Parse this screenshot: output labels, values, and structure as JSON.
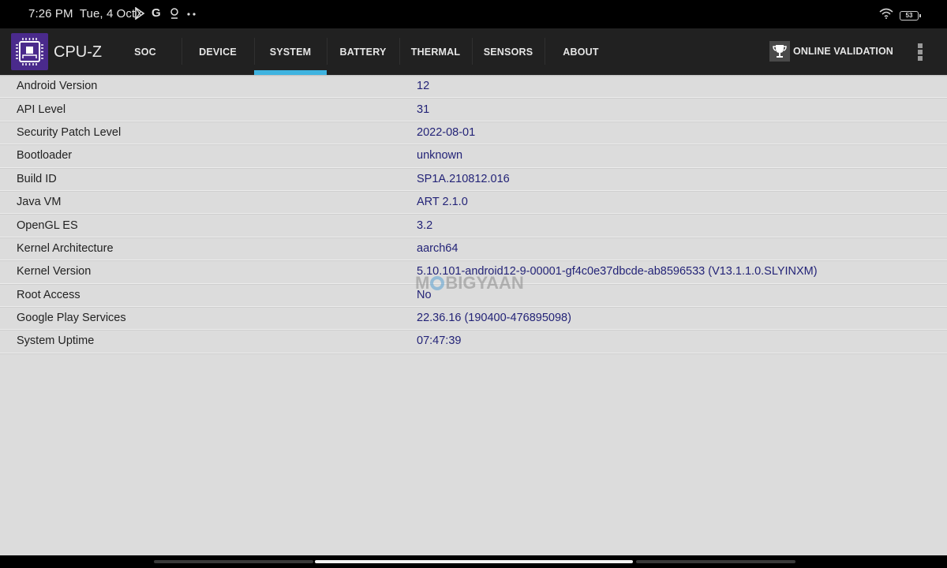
{
  "status_bar": {
    "time": "7:26 PM",
    "date": "Tue, 4 Oct",
    "notification_icons": [
      "play-store-icon",
      "google-icon",
      "location-pin-icon",
      "more-dots-icon"
    ],
    "battery_level": "53",
    "wifi": "wifi-icon"
  },
  "app_bar": {
    "title": "CPU-Z",
    "logo_icon": "cpu-chip-icon",
    "tabs": [
      {
        "label": "SOC",
        "active": false
      },
      {
        "label": "DEVICE",
        "active": false
      },
      {
        "label": "SYSTEM",
        "active": true
      },
      {
        "label": "BATTERY",
        "active": false
      },
      {
        "label": "THERMAL",
        "active": false
      },
      {
        "label": "SENSORS",
        "active": false
      },
      {
        "label": "ABOUT",
        "active": false
      }
    ],
    "validation_label": "ONLINE VALIDATION",
    "validation_icon": "trophy-icon",
    "menu_icon": "overflow-menu-icon",
    "accent_color": "#3fb3e0",
    "logo_color": "#4a2a8c"
  },
  "system_info": {
    "rows": [
      {
        "label": "Android Version",
        "value": "12"
      },
      {
        "label": "API Level",
        "value": "31"
      },
      {
        "label": "Security Patch Level",
        "value": "2022-08-01"
      },
      {
        "label": "Bootloader",
        "value": "unknown"
      },
      {
        "label": "Build ID",
        "value": "SP1A.210812.016"
      },
      {
        "label": "Java VM",
        "value": "ART 2.1.0"
      },
      {
        "label": "OpenGL ES",
        "value": "3.2"
      },
      {
        "label": "Kernel Architecture",
        "value": "aarch64"
      },
      {
        "label": "Kernel Version",
        "value": "5.10.101-android12-9-00001-gf4c0e37dbcde-ab8596533 (V13.1.1.0.SLYINXM)"
      },
      {
        "label": "Root Access",
        "value": "No"
      },
      {
        "label": "Google Play Services",
        "value": "22.36.16 (190400-476895098)"
      },
      {
        "label": "System Uptime",
        "value": "07:47:39"
      }
    ]
  },
  "watermark": {
    "prefix": "M",
    "suffix": "BIGYAAN"
  }
}
